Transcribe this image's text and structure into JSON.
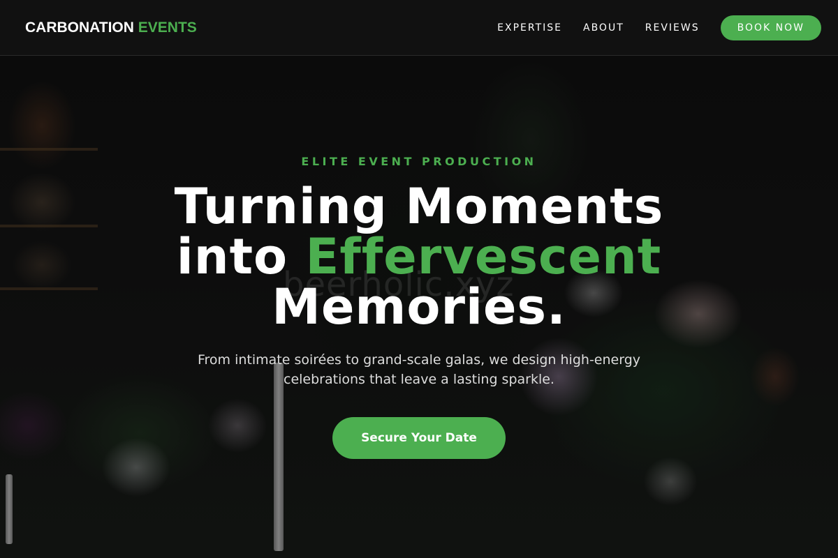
{
  "brand": {
    "name_primary": "CARBONATION",
    "name_accent": "EVENTS",
    "accent_color": "#4caf50"
  },
  "nav": {
    "items": [
      {
        "label": "EXPERTISE"
      },
      {
        "label": "ABOUT"
      },
      {
        "label": "REVIEWS"
      }
    ],
    "cta_label": "BOOK NOW"
  },
  "hero": {
    "eyebrow": "ELITE EVENT PRODUCTION",
    "headline_line1": "Turning Moments",
    "headline_line2_prefix": "into ",
    "headline_line2_accent": "Effervescent",
    "headline_line3": "Memories.",
    "subtitle": "From intimate soirées to grand-scale galas, we design high-energy celebrations that leave a lasting sparkle.",
    "cta_label": "Secure Your Date",
    "watermark": "beerholic.xyz"
  },
  "colors": {
    "header_bg": "#111111",
    "accent": "#4caf50",
    "text": "#ffffff"
  }
}
